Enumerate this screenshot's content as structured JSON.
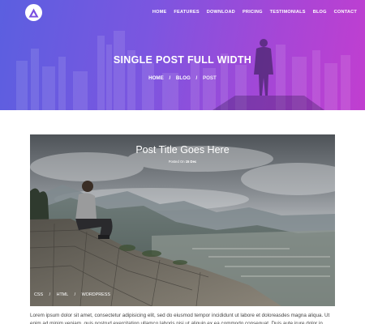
{
  "nav": {
    "items": [
      "HOME",
      "FEATURES",
      "DOWNLOAD",
      "PRICING",
      "TESTIMONIALS",
      "BLOG",
      "CONTACT"
    ]
  },
  "hero": {
    "title": "SINGLE POST FULL WIDTH",
    "breadcrumb": {
      "home": "HOME",
      "blog": "BLOG",
      "current": "POST",
      "separator": "/"
    }
  },
  "post": {
    "title": "Post Title Goes Here",
    "meta_prefix": "Posted On",
    "meta_date": "15 Dec",
    "tags": [
      "CSS",
      "HTML",
      "WORDPRESS"
    ],
    "tag_separator": "/",
    "body": "Lorem ipsum dolor sit amet, consectetur adipisicing elit, sed do eiusmod tempor incididunt ut labore et doloreasdes magna aliqua. Ut enim ad minim veniam, quis nostrud exercitation ullamco laboris nisi ut aliquip ex ea commodo consequat. Duis aute irure dolor in"
  },
  "colors": {
    "gradient_start": "#5b5fe0",
    "gradient_end": "#c13ed0",
    "logo_accent": "#7a4fe0",
    "body_text": "#444444"
  },
  "icons": {
    "logo": "triangle-a-logo-icon"
  }
}
